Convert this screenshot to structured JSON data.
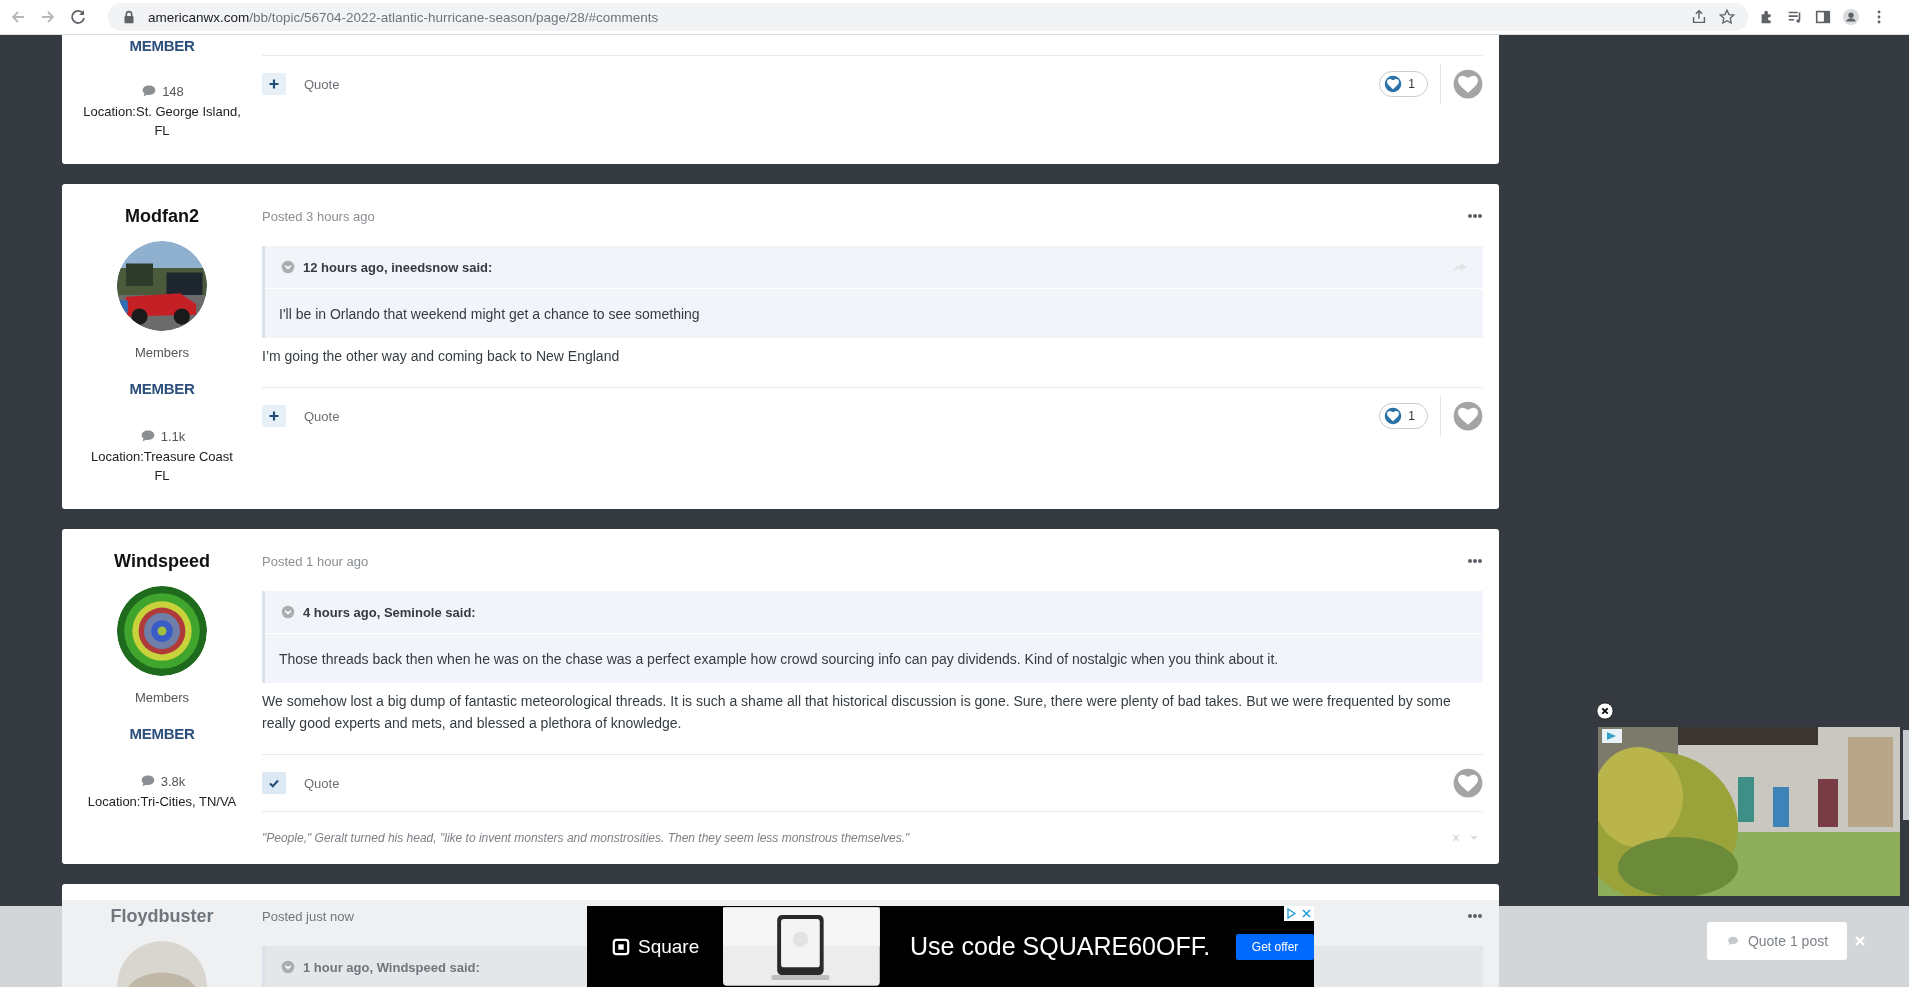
{
  "browser": {
    "url_host": "americanwx.com",
    "url_path": "/bb/topic/56704-2022-atlantic-hurricane-season/page/28/#comments"
  },
  "posts": [
    {
      "rank": "MEMBER",
      "post_count": "148",
      "location": "Location:St. George Island, FL",
      "multiquote_selected": false,
      "quote_label": "Quote",
      "likes": "1"
    },
    {
      "author": "Modfan2",
      "role": "Members",
      "rank": "MEMBER",
      "post_count": "1.1k",
      "location": "Location:Treasure Coast FL",
      "posted": "Posted 3 hours ago",
      "quote": {
        "header": "12 hours ago, ineedsnow said:",
        "text": "I'll be in Orlando that weekend might get a chance to see something",
        "share_visible": true
      },
      "body": "I’m going the other way and coming back to New England",
      "multiquote_selected": false,
      "quote_label": "Quote",
      "likes": "1"
    },
    {
      "author": "Windspeed",
      "role": "Members",
      "rank": "MEMBER",
      "post_count": "3.8k",
      "location": "Location:Tri-Cities, TN/VA",
      "posted": "Posted 1 hour ago",
      "quote": {
        "header": "4 hours ago, Seminole said:",
        "text": "Those threads back then when he was on the chase was a perfect example how crowd sourcing info can pay dividends. Kind of nostalgic when you think about it.",
        "share_visible": false
      },
      "body": "We somehow lost a big dump of fantastic meteorological threads. It is such a shame all that historical discussion is gone. Sure, there were plenty of bad takes. But we were frequented by some really good experts and mets, and blessed a plethora of knowledge.",
      "multiquote_selected": true,
      "quote_label": "Quote",
      "signature": "\"People,\" Geralt turned his head, \"like to invent monsters and monstrosities. Then they seem less monstrous themselves.\""
    },
    {
      "author": "Floydbuster",
      "posted": "Posted just now",
      "quote": {
        "header": "1 hour ago, Windspeed said:"
      }
    }
  ],
  "banner_ad": {
    "brand": "Square",
    "headline": "Use code SQUARE60OFF.",
    "button": "Get offer"
  },
  "multiquote_bar": {
    "button": "Quote 1 post"
  }
}
